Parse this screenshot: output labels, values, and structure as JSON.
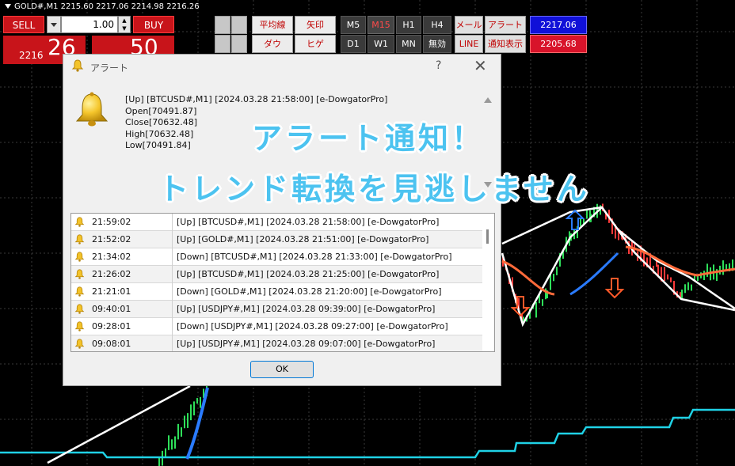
{
  "chart": {
    "symbol_line": "GOLD#,M1  2215.60 2217.06 2214.98 2216.26",
    "colors": {
      "background": "#000000",
      "grid": "#3a3a3a",
      "trend_line": "#ffffff",
      "support_line": "#1fd2e6",
      "bull": "#2ee05a",
      "bear": "#ff3a3a",
      "band_blue": "#2a7bff",
      "band_red": "#ff6a3a"
    }
  },
  "trade_panel": {
    "sell_label": "SELL",
    "buy_label": "BUY",
    "lot": "1.00",
    "sell_price_prefix": "2216",
    "sell_price_big": "26",
    "buy_price_big": "50"
  },
  "toolbar": {
    "ma": "平均線",
    "arrow": "矢印",
    "dow": "ダウ",
    "wick": "ヒゲ",
    "tf_m5": "M5",
    "tf_m15": "M15",
    "tf_h1": "H1",
    "tf_h4": "H4",
    "tf_d1": "D1",
    "tf_w1": "W1",
    "tf_mn": "MN",
    "tf_off": "無効",
    "mail": "メール",
    "alert": "アラート",
    "line": "LINE",
    "notify": "通知表示",
    "price_high": "2217.06",
    "price_low": "2205.68"
  },
  "dialog": {
    "title": "アラート",
    "help": "?",
    "close": "✕",
    "message": {
      "line1": "[Up] [BTCUSD#,M1] [2024.03.28 21:58:00] [e-DowgatorPro]",
      "line2": "Open[70491.87]",
      "line3": "Close[70632.48]",
      "line4": "High[70632.48]",
      "line5": "Low[70491.84]"
    },
    "rows": [
      {
        "time": "21:59:02",
        "text": "[Up] [BTCUSD#,M1] [2024.03.28 21:58:00] [e-DowgatorPro]"
      },
      {
        "time": "21:52:02",
        "text": "[Up] [GOLD#,M1] [2024.03.28 21:51:00] [e-DowgatorPro]"
      },
      {
        "time": "21:34:02",
        "text": "[Down] [BTCUSD#,M1] [2024.03.28 21:33:00] [e-DowgatorPro]"
      },
      {
        "time": "21:26:02",
        "text": "[Up] [BTCUSD#,M1] [2024.03.28 21:25:00] [e-DowgatorPro]"
      },
      {
        "time": "21:21:01",
        "text": "[Down] [GOLD#,M1] [2024.03.28 21:20:00] [e-DowgatorPro]"
      },
      {
        "time": "09:40:01",
        "text": "[Up] [USDJPY#,M1] [2024.03.28 09:39:00] [e-DowgatorPro]"
      },
      {
        "time": "09:28:01",
        "text": "[Down] [USDJPY#,M1] [2024.03.28 09:27:00] [e-DowgatorPro]"
      },
      {
        "time": "09:08:01",
        "text": "[Up] [USDJPY#,M1] [2024.03.28 09:07:00] [e-DowgatorPro]"
      }
    ],
    "ok_label": "OK"
  },
  "promo": {
    "line1": "アラート通知！",
    "line2": "トレンド転換を見逃しません"
  }
}
